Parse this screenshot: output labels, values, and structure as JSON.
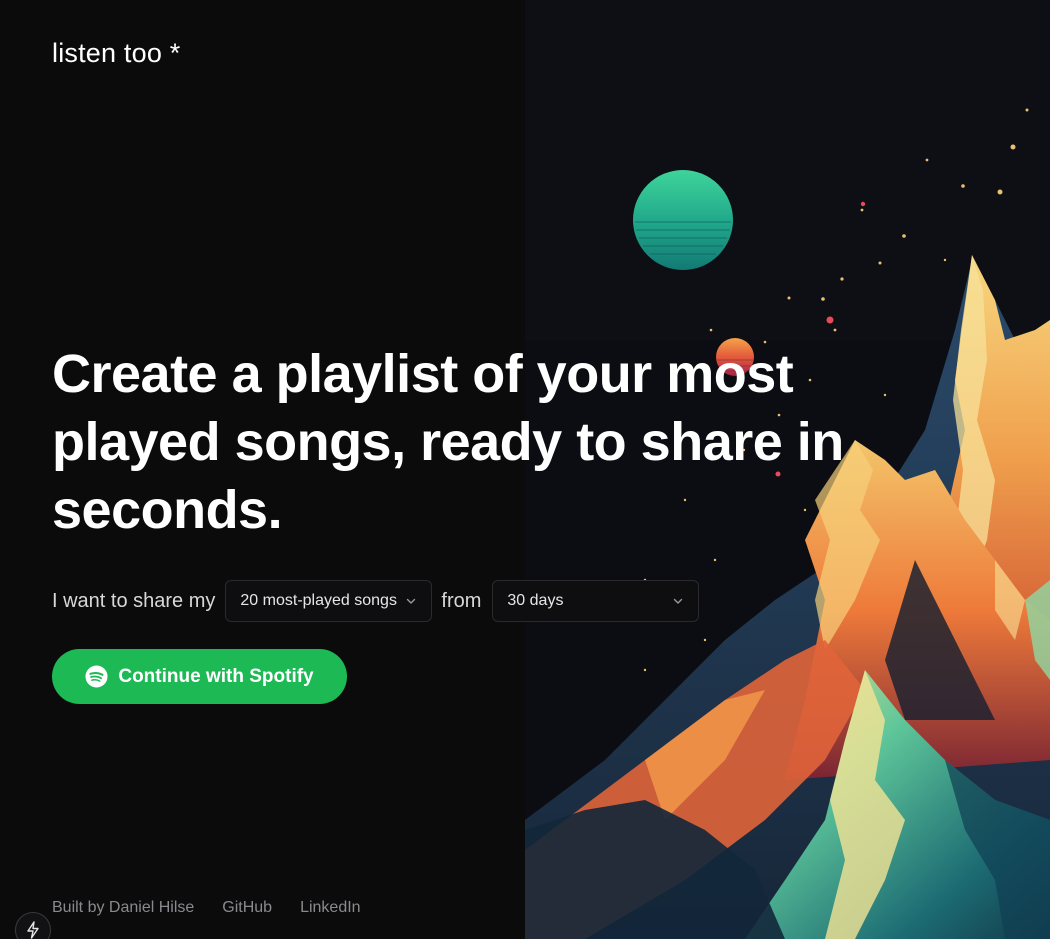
{
  "logo": "listen too *",
  "headline": "Create a playlist of your most played songs, ready to share in seconds.",
  "share_row": {
    "prefix": "I want to share my",
    "songs_select_value": "20 most-played songs",
    "from_label": "from",
    "range_select_value": "30 days"
  },
  "cta": {
    "label": "Continue with Spotify",
    "icon": "spotify-icon",
    "color": "#1db954"
  },
  "footer": {
    "built_by": "Built by Daniel Hilse",
    "github": "GitHub",
    "linkedin": "LinkedIn"
  },
  "corner_badge_icon": "lightning-bolt-icon",
  "artwork_icon": "mountain-illustration"
}
